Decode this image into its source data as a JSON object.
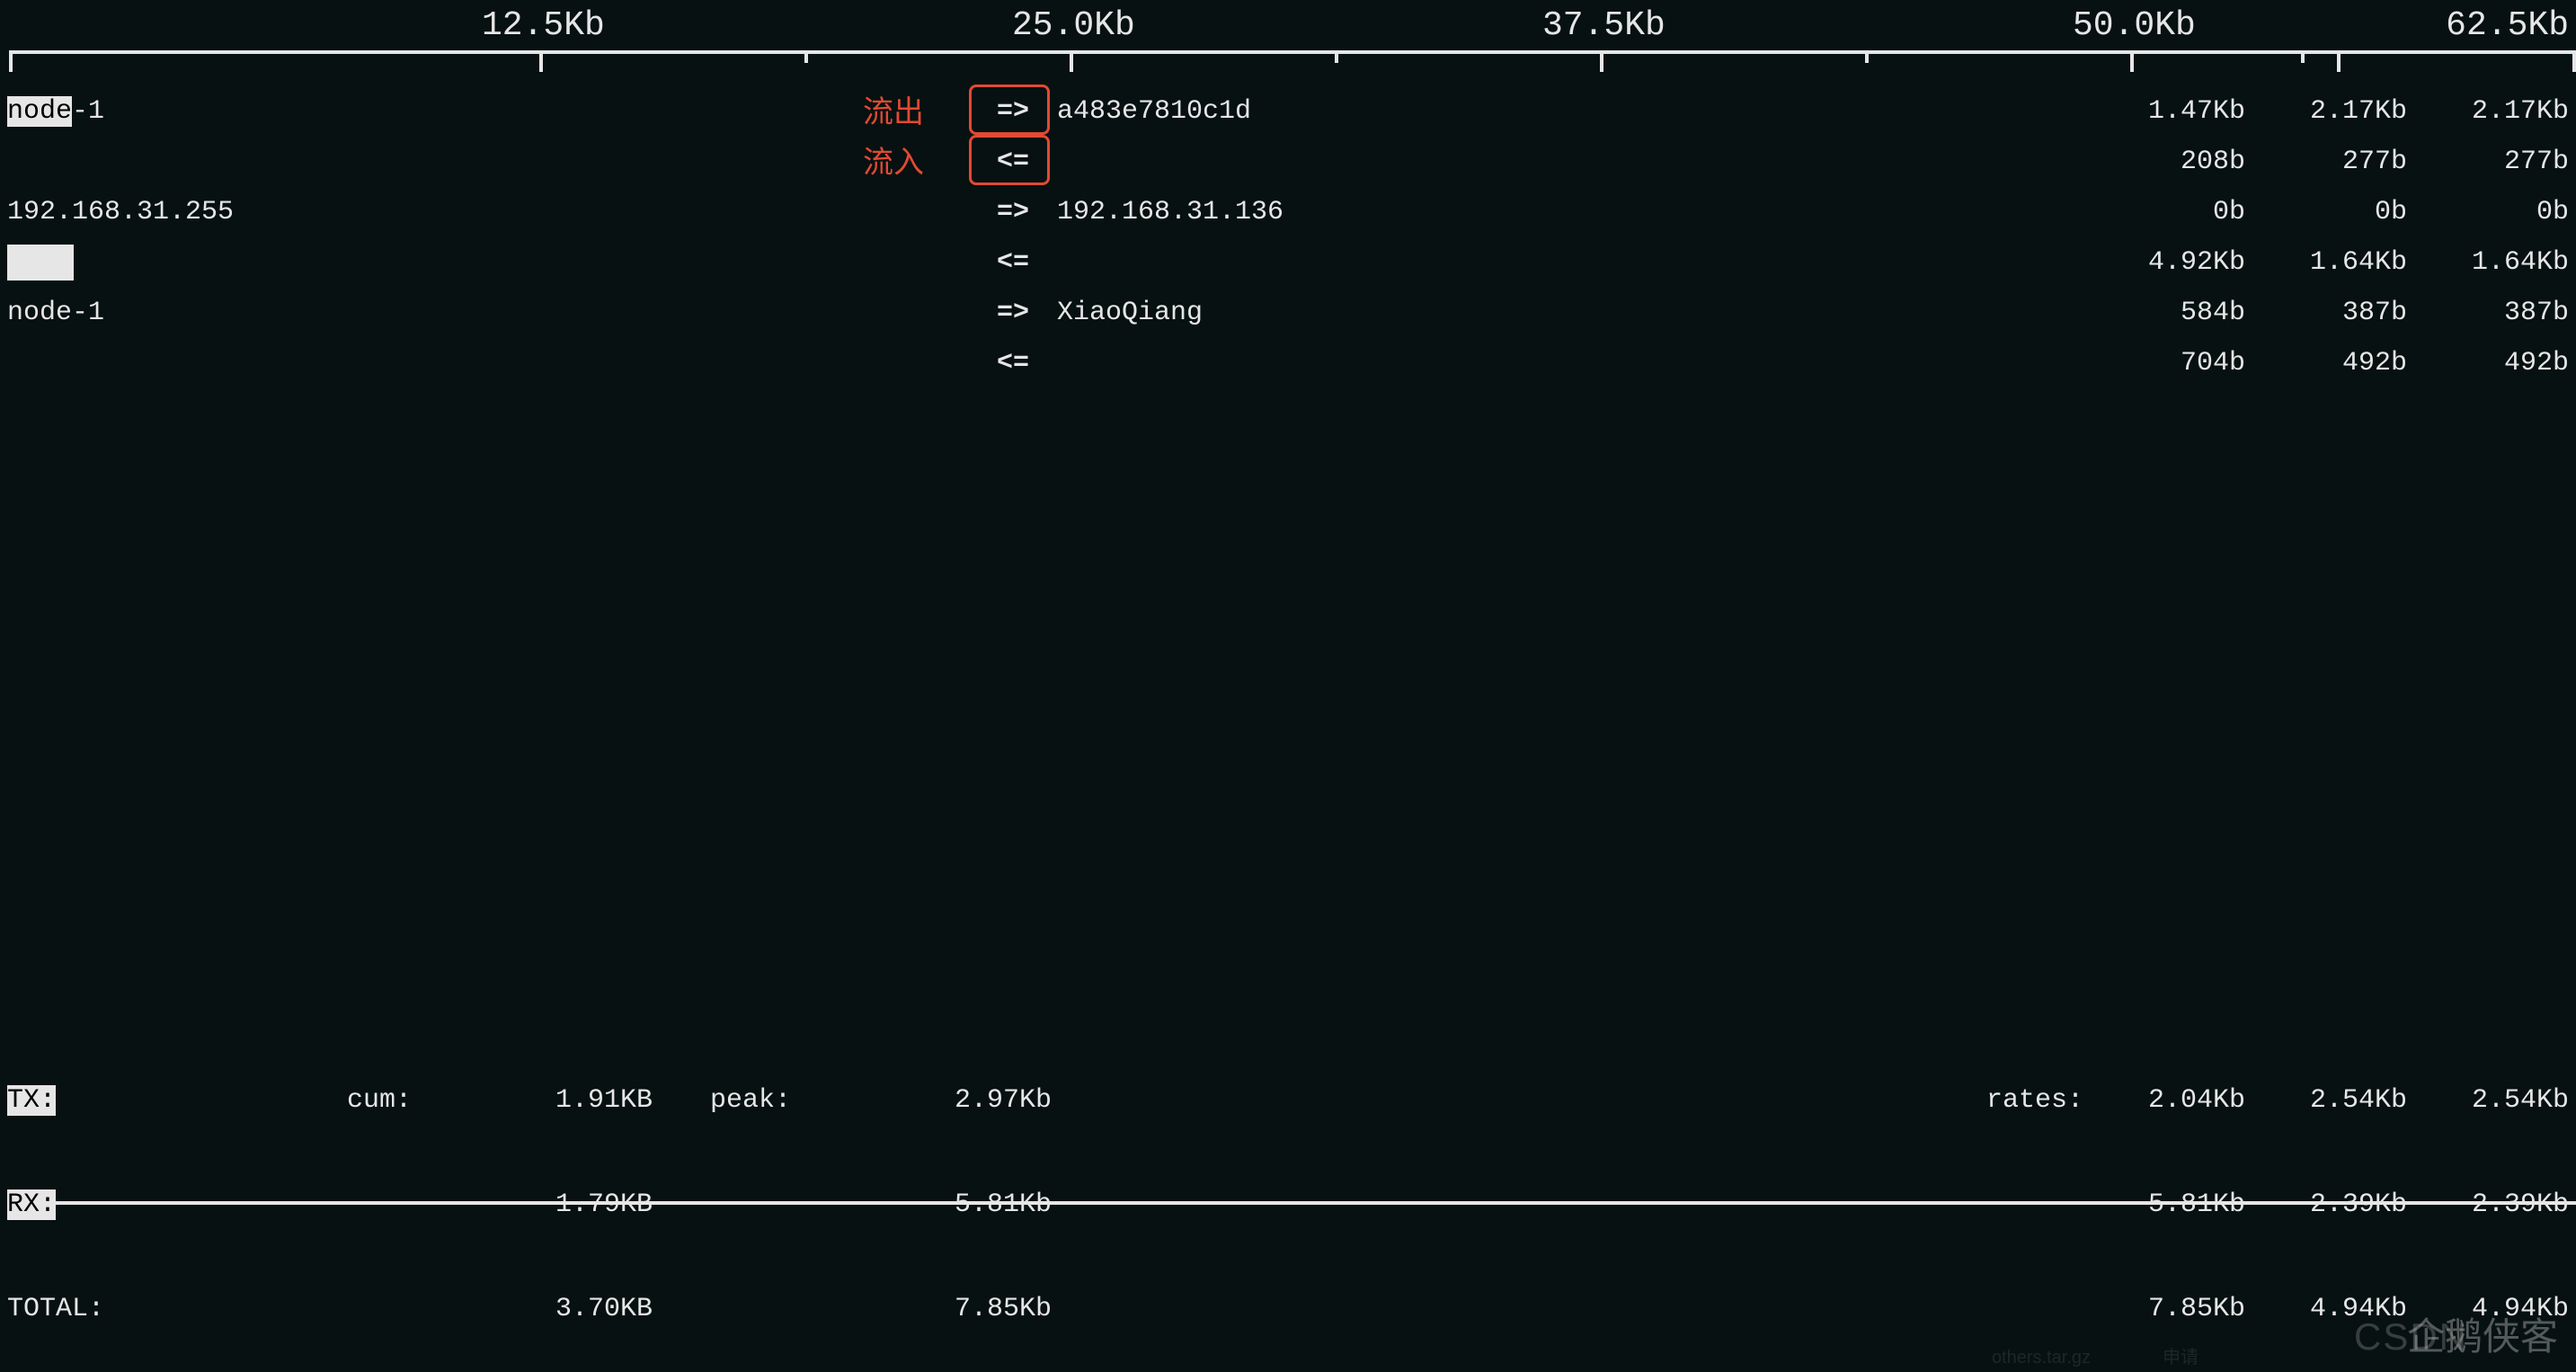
{
  "scale": {
    "ticks": [
      "12.5Kb",
      "25.0Kb",
      "37.5Kb",
      "50.0Kb",
      "62.5Kb"
    ]
  },
  "arrows": {
    "out": "=>",
    "in": "<="
  },
  "annotations": {
    "out": "流出",
    "in": "流入"
  },
  "connections": [
    {
      "src": "node-1",
      "dst": "a483e7810c1d",
      "src_hl_chars": 4,
      "out": {
        "r1": "1.47Kb",
        "r2": "2.17Kb",
        "r3": "2.17Kb"
      },
      "in": {
        "r1": "208b",
        "r2": "277b",
        "r3": "277b"
      }
    },
    {
      "src": "192.168.31.255",
      "dst": "192.168.31.136",
      "src_hl_chars": 0,
      "out": {
        "r1": "0b",
        "r2": "0b",
        "r3": "0b"
      },
      "in": {
        "r1": "4.92Kb",
        "r2": "1.64Kb",
        "r3": "1.64Kb"
      }
    },
    {
      "src": "node-1",
      "dst": "XiaoQiang",
      "src_hl_chars": 0,
      "out": {
        "r1": "584b",
        "r2": "387b",
        "r3": "387b"
      },
      "in": {
        "r1": "704b",
        "r2": "492b",
        "r3": "492b"
      }
    }
  ],
  "footer": {
    "labels": {
      "tx": "TX:",
      "rx": "RX:",
      "total": "TOTAL:",
      "cum": "cum:",
      "peak": "peak:",
      "rates": "rates:"
    },
    "tx": {
      "cum": "1.91KB",
      "peak": "2.97Kb",
      "r1": "2.04Kb",
      "r2": "2.54Kb",
      "r3": "2.54Kb"
    },
    "rx": {
      "cum": "1.79KB",
      "peak": "5.81Kb",
      "r1": "5.81Kb",
      "r2": "2.39Kb",
      "r3": "2.39Kb"
    },
    "total": {
      "cum": "3.70KB",
      "peak": "7.85Kb",
      "r1": "7.85Kb",
      "r2": "4.94Kb",
      "r3": "4.94Kb"
    }
  },
  "watermarks": {
    "w1": "CSDN",
    "w2": "企鹅侠客"
  },
  "ghost": {
    "file": "others.tar.gz",
    "app": "申请"
  }
}
